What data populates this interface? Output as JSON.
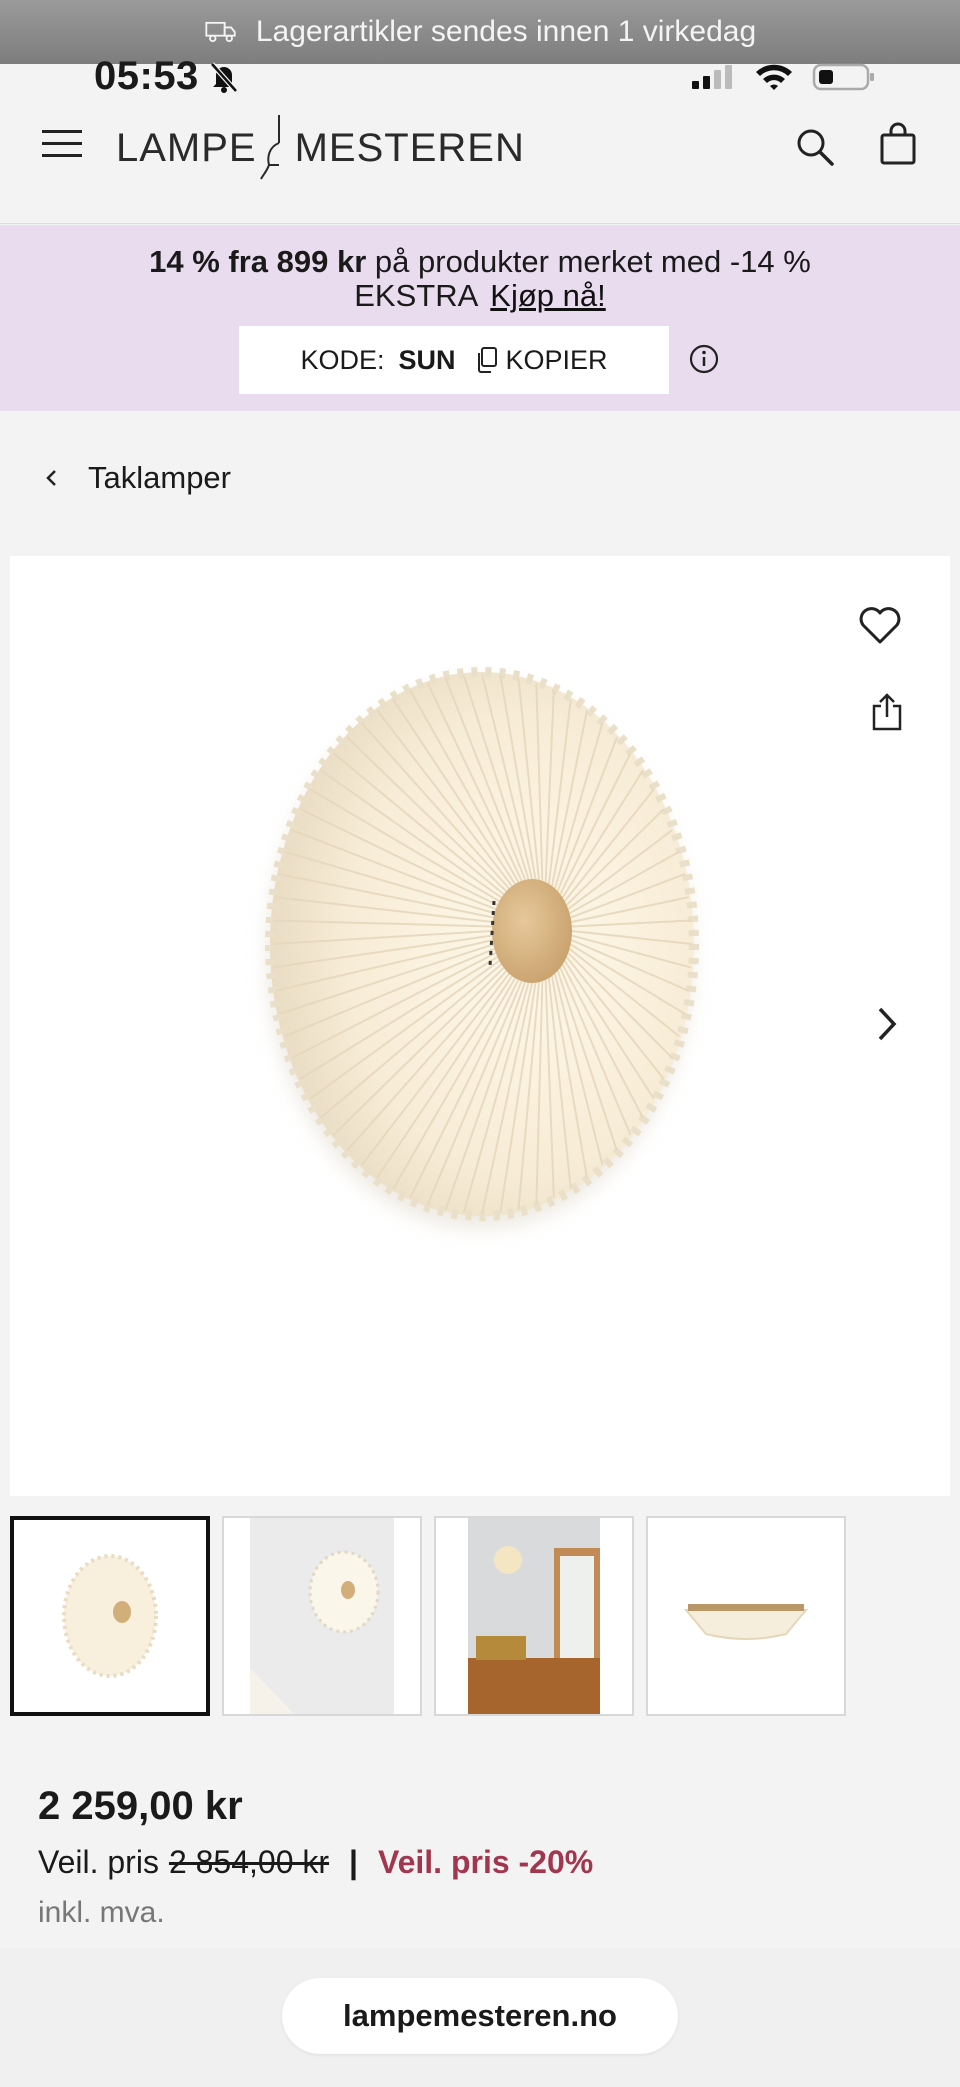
{
  "announcement": {
    "text": "Lagerartikler sendes innen 1 virkedag",
    "icon": "truck-icon"
  },
  "status_bar": {
    "time": "05:53"
  },
  "header": {
    "logo_left": "LAMPE",
    "logo_right": "MESTEREN"
  },
  "promo": {
    "bold": "14 % fra 899 kr",
    "text": " på produkter merket med -14 %",
    "line2": "EKSTRA",
    "link": "Kjøp nå!",
    "code_label": "KODE:",
    "code": "SUN",
    "copy_label": "KOPIER",
    "background": "#e8dcee"
  },
  "breadcrumb": {
    "label": "Taklamper"
  },
  "product": {
    "price": "2 259,00 kr",
    "was_label": "Veil. pris",
    "was_price": "2 854,00 kr",
    "separator": "|",
    "discount": "Veil. pris -20%",
    "vat": "inkl. mva.",
    "discount_color": "#a3364f"
  },
  "browser": {
    "url": "lampemesteren.no"
  }
}
